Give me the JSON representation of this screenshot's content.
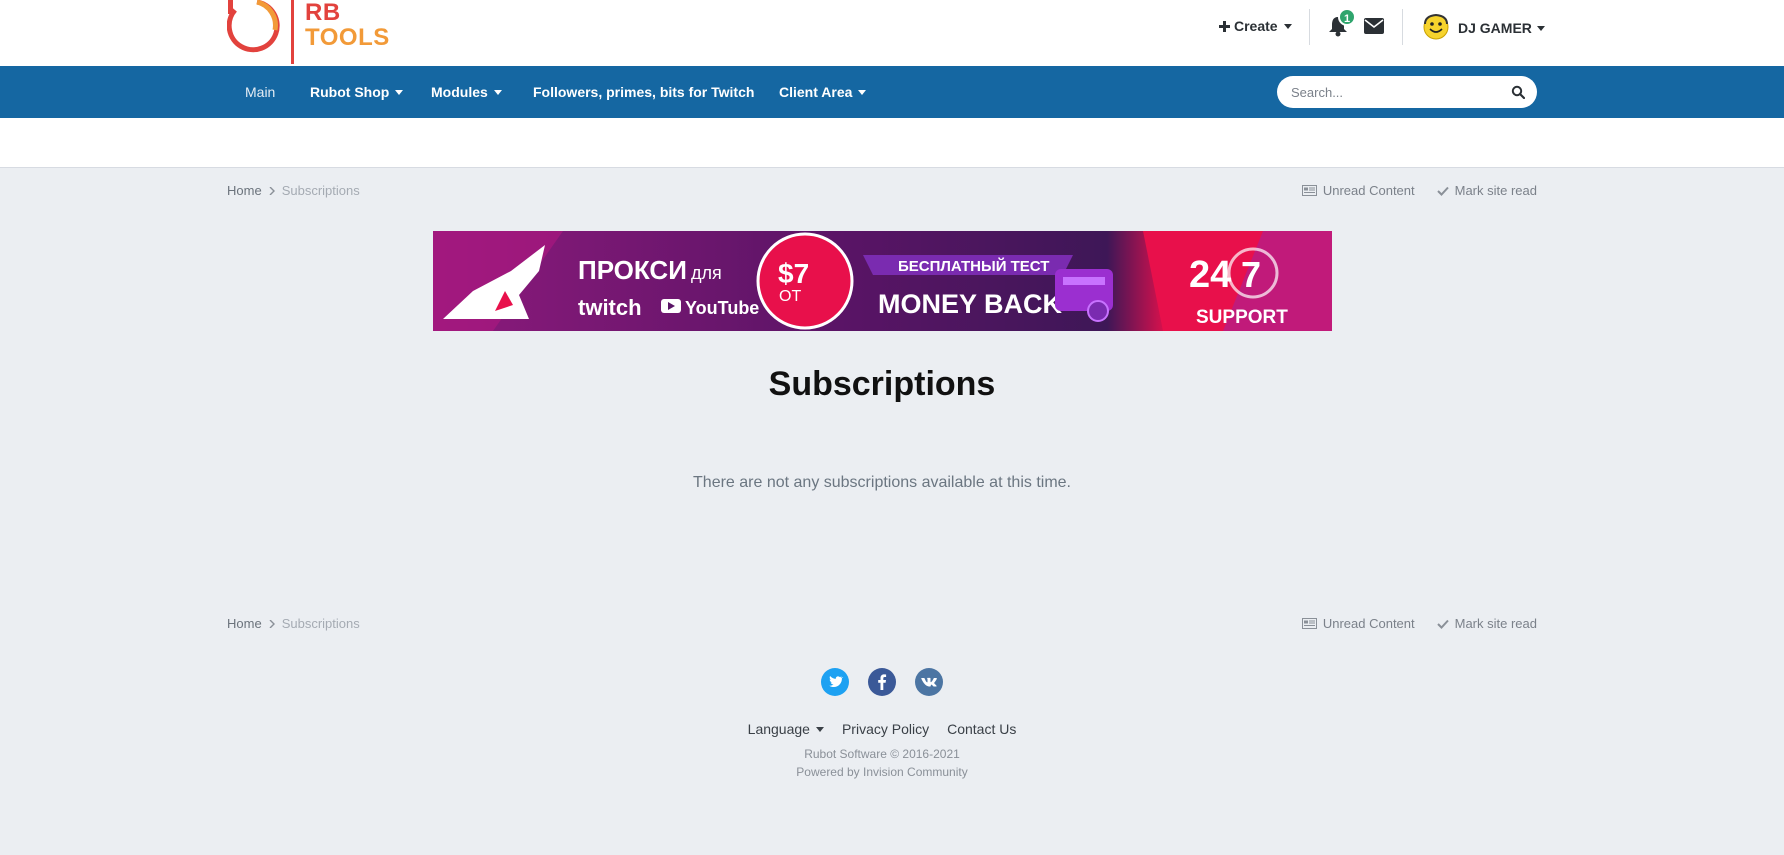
{
  "header": {
    "logo_line1": "RB",
    "logo_line2": "TOOLS",
    "create_label": "Create",
    "notification_count": "1",
    "username": "DJ GAMER"
  },
  "nav": {
    "items": [
      {
        "label": "Main"
      },
      {
        "label": "Rubot Shop"
      },
      {
        "label": "Modules"
      },
      {
        "label": "Followers, primes, bits for Twitch"
      },
      {
        "label": "Client Area"
      }
    ],
    "search_placeholder": "Search..."
  },
  "breadcrumb": {
    "home": "Home",
    "current": "Subscriptions",
    "unread": "Unread Content",
    "mark_read": "Mark site read"
  },
  "banner": {
    "proxy": "ПРОКСИ",
    "for": "для",
    "twitch": "twitch",
    "youtube": "YouTube",
    "price": "$7",
    "from": "ОТ",
    "free_test": "БЕСПЛАТНЫЙ ТЕСТ",
    "money_back": "MONEY BACK",
    "hours": "24",
    "days": "7",
    "support": "SUPPORT"
  },
  "main": {
    "title": "Subscriptions",
    "empty_message": "There are not any subscriptions available at this time."
  },
  "footer": {
    "language": "Language",
    "privacy": "Privacy Policy",
    "contact": "Contact Us",
    "copyright": "Rubot Software © 2016-2021",
    "powered": "Powered by Invision Community"
  },
  "colors": {
    "nav_blue": "#1567a2",
    "page_bg": "#ebeef2",
    "logo_red": "#e2423d",
    "logo_orange": "#f29a38",
    "badge_green": "#2fa56d",
    "twitter": "#1da1f2",
    "facebook": "#3b5998",
    "vk": "#4c75a3"
  }
}
